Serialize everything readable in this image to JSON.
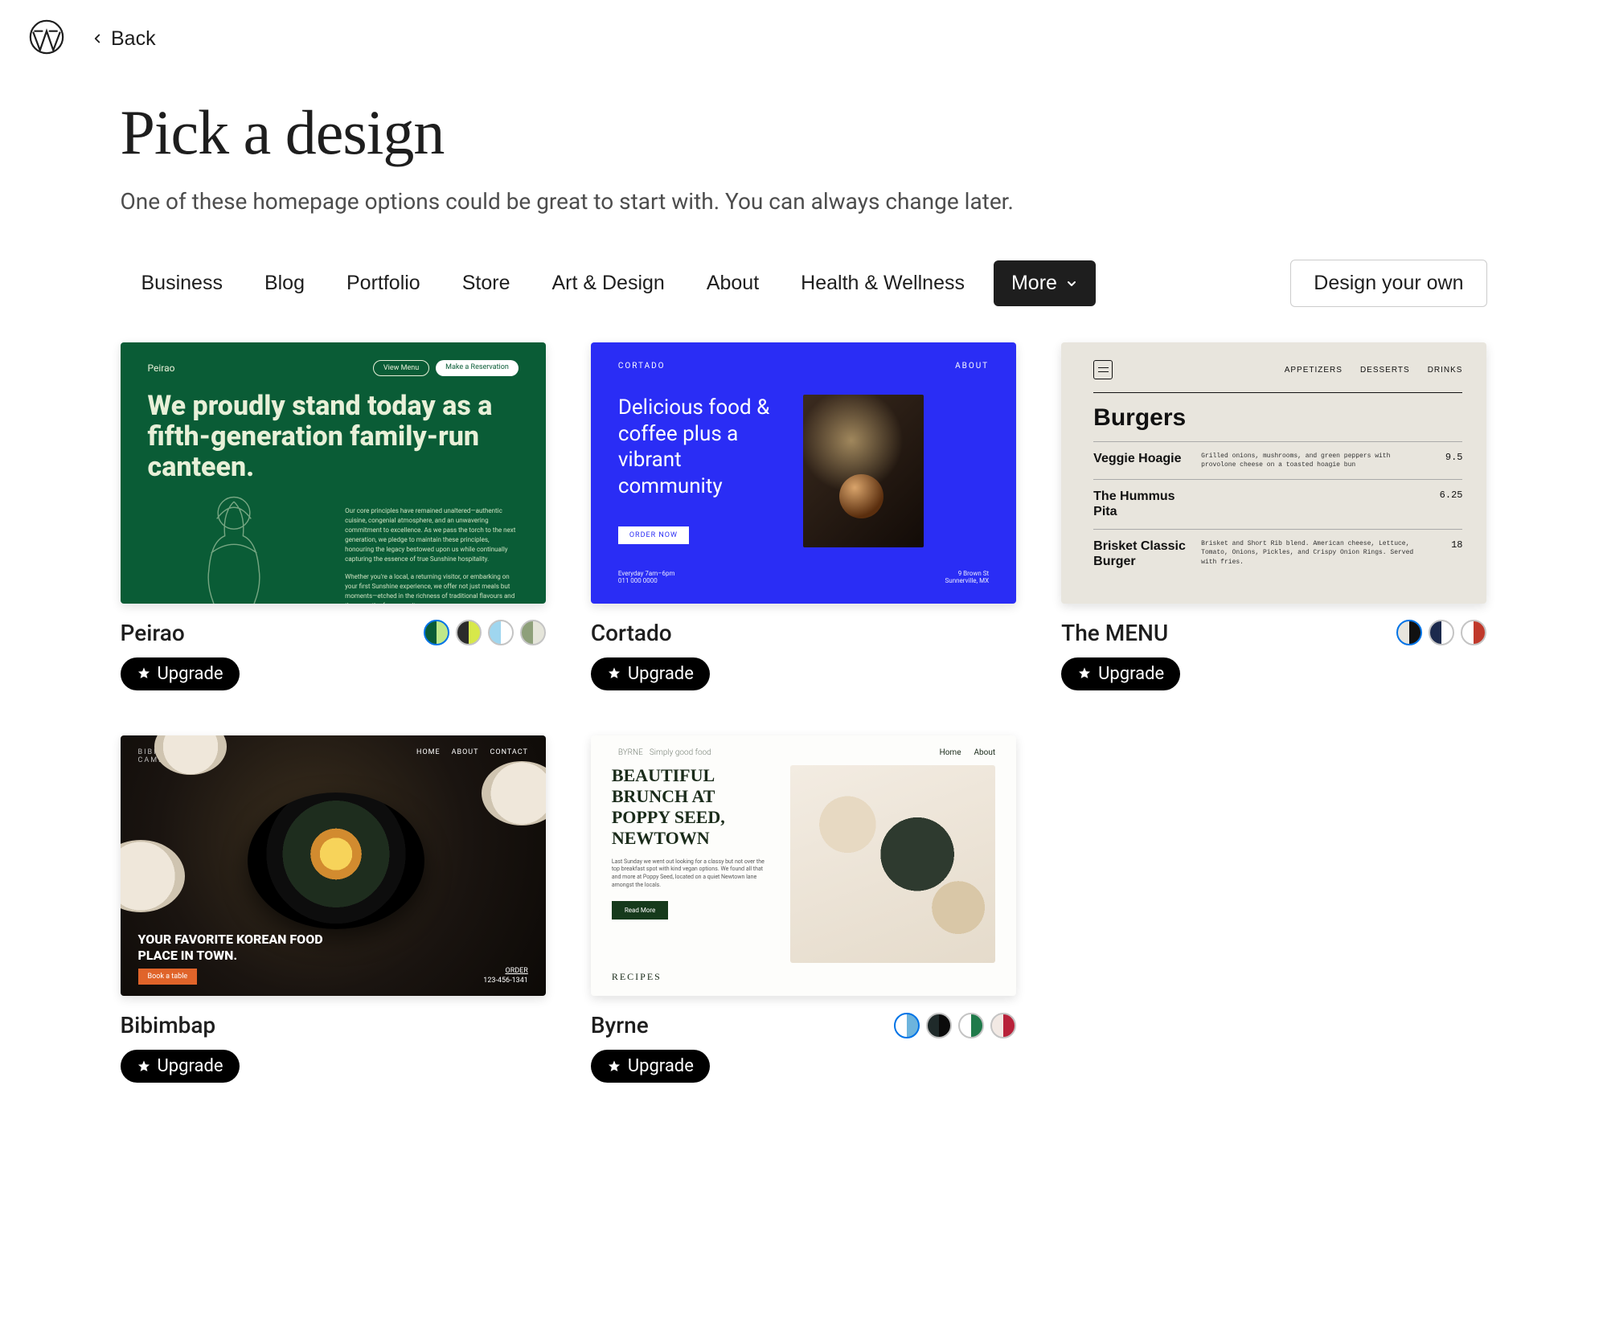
{
  "back_label": "Back",
  "page_title": "Pick a design",
  "page_subtitle": "One of these homepage options could be great to start with. You can always change later.",
  "categories": [
    "Business",
    "Blog",
    "Portfolio",
    "Store",
    "Art & Design",
    "About",
    "Health & Wellness"
  ],
  "more_label": "More",
  "design_own_label": "Design your own",
  "upgrade_label": "Upgrade",
  "templates": [
    {
      "id": "peirao",
      "name": "Peirao",
      "swatches": [
        {
          "c1": "#0a5c36",
          "c2": "#bfe88a",
          "selected": true
        },
        {
          "c1": "#2b2b2b",
          "c2": "#d7e84a",
          "selected": false
        },
        {
          "c1": "#9fd6ef",
          "c2": "#ffffff",
          "selected": false
        },
        {
          "c1": "#8ea07a",
          "c2": "#e5e5da",
          "selected": false
        }
      ],
      "preview": {
        "brand": "Peirao",
        "pill1": "View Menu",
        "pill2": "Make a Reservation",
        "hero": "We proudly stand today as a fifth-generation family-run canteen.",
        "para1": "Our core principles have remained unaltered—authentic cuisine, congenial atmosphere, and an unwavering commitment to excellence. As we pass the torch to the next generation, we pledge to maintain these principles, honouring the legacy bestowed upon us while continually capturing the essence of true Sunshine hospitality.",
        "para2": "Whether you're a local, a returning visitor, or embarking on your first Sunshine experience, we offer not just meals but moments—etched in the richness of traditional flavours and the warmth of community."
      }
    },
    {
      "id": "cortado",
      "name": "Cortado",
      "swatches": [],
      "preview": {
        "brand": "CORTADO",
        "nav": "ABOUT",
        "hero": "Delicious food & coffee plus a vibrant community",
        "btn": "ORDER NOW",
        "foot1": "Everyday 7am–6pm\n011 000 0000",
        "foot2": "9 Brown St\nSunnerville, MX"
      }
    },
    {
      "id": "the-menu",
      "name": "The MENU",
      "swatches": [
        {
          "c1": "#e8e5dd",
          "c2": "#111111",
          "selected": true
        },
        {
          "c1": "#1c2a4d",
          "c2": "#ffffff",
          "selected": false
        },
        {
          "c1": "#ffffff",
          "c2": "#c0392b",
          "selected": false
        }
      ],
      "preview": {
        "links": [
          "APPETIZERS",
          "DESSERTS",
          "DRINKS"
        ],
        "heading": "Burgers",
        "rows": [
          {
            "name": "Veggie Hoagie",
            "desc": "Grilled onions, mushrooms, and green peppers with provolone cheese on a toasted hoagie bun",
            "price": "9.5"
          },
          {
            "name": "The Hummus Pita",
            "desc": "",
            "price": "6.25"
          },
          {
            "name": "Brisket Classic Burger",
            "desc": "Brisket and Short Rib blend. American cheese, Lettuce, Tomato, Onions, Pickles, and Crispy Onion Rings. Served with fries.",
            "price": "18"
          }
        ]
      }
    },
    {
      "id": "bibimbap",
      "name": "Bibimbap",
      "swatches": [],
      "preview": {
        "brand": "BIBIMBAP",
        "brand_sub": "CAMBRIDGE, MA",
        "nav": [
          "HOME",
          "ABOUT",
          "CONTACT"
        ],
        "tagline": "YOUR FAVORITE KOREAN FOOD PLACE IN TOWN.",
        "cta": "Book a table",
        "order": "ORDER",
        "phone": "123-456-1341"
      }
    },
    {
      "id": "byrne",
      "name": "Byrne",
      "swatches": [
        {
          "c1": "#ffffff",
          "c2": "#6db4dd",
          "selected": true
        },
        {
          "c1": "#1f2a2a",
          "c2": "#0b0b0b",
          "selected": false
        },
        {
          "c1": "#ffffff",
          "c2": "#1f7a4a",
          "selected": false
        },
        {
          "c1": "#f2e9e4",
          "c2": "#b8223a",
          "selected": false
        }
      ],
      "preview": {
        "brand": "BYRNE",
        "brand_sub": "Simply good food",
        "nav": [
          "Home",
          "About"
        ],
        "heading": "BEAUTIFUL BRUNCH AT POPPY SEED, NEWTOWN",
        "copy": "Last Sunday we went out looking for a classy but not over the top breakfast spot with kind vegan options. We found all that and more at Poppy Seed, located on a quiet Newtown lane amongst the locals.",
        "btn": "Read More",
        "footer": "RECIPES"
      }
    }
  ]
}
